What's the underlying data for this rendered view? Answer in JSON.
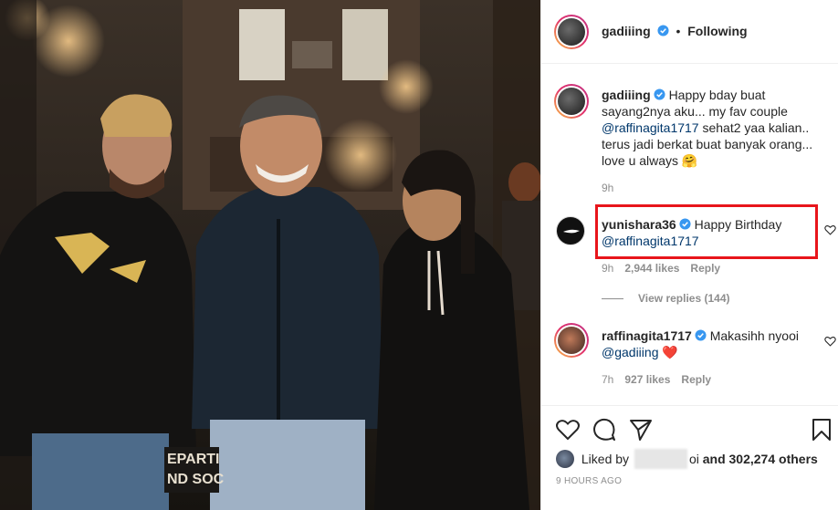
{
  "post": {
    "author": "gadiiing",
    "follow_status": "Following",
    "dot": "•"
  },
  "comments": [
    {
      "username": "gadiiing",
      "text_before": "Happy bday buat sayang2nya aku... my fav couple",
      "mention": "@raffinagita1717",
      "text_after": "sehat2 yaa kalian.. terus jadi berkat buat banyak orang... love u always 🤗",
      "time": "9h"
    },
    {
      "username": "yunishara36",
      "text_before": "Happy Birthday",
      "mention": "@raffinagita1717",
      "time": "9h",
      "likes": "2,944 likes",
      "reply": "Reply",
      "view_replies": "View replies (144)"
    },
    {
      "username": "raffinagita1717",
      "text_before": "Makasihh nyooi",
      "mention": "@gadiiing",
      "emoji": "❤️",
      "time": "7h",
      "likes": "927 likes",
      "reply": "Reply"
    }
  ],
  "likes_line": {
    "prefix": "Liked by",
    "blur_suffix": "oi",
    "conjunction": "and",
    "count": "302,274 others"
  },
  "timestamp": "9 HOURS AGO",
  "photo_sign": [
    "EPARTI",
    "ND SOC"
  ],
  "icons": [
    "heart-icon",
    "comment-icon",
    "share-icon",
    "bookmark-icon",
    "verified-icon"
  ],
  "colors": {
    "highlight": "#e8151b",
    "verified": "#3897f0",
    "mention": "#00376b"
  }
}
